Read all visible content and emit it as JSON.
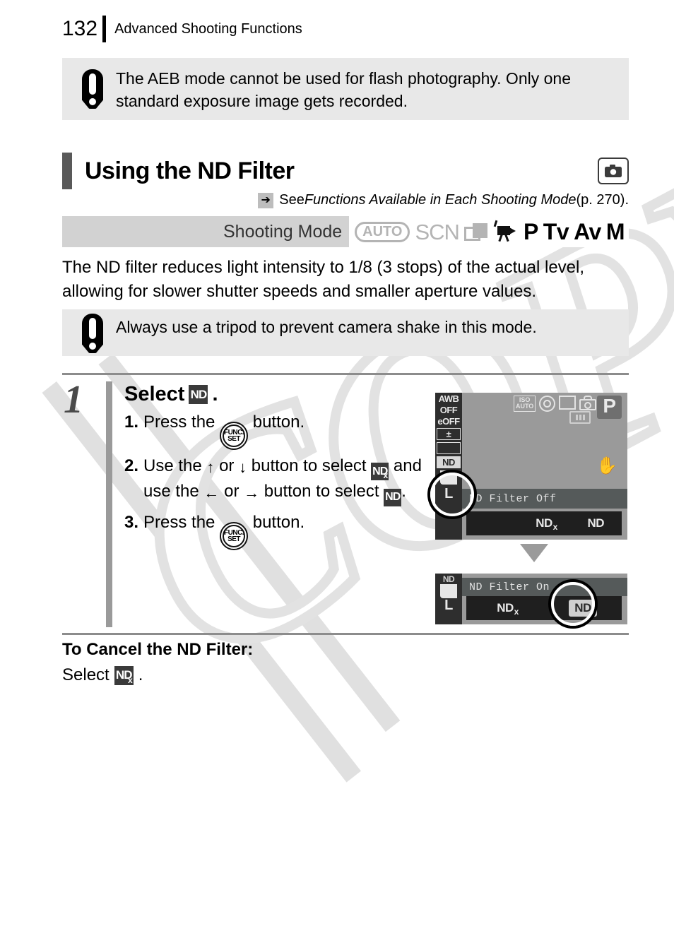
{
  "page": {
    "number": "132",
    "running_title": "Advanced Shooting Functions"
  },
  "notes": {
    "aeb": "The AEB mode cannot be used for flash photography. Only one standard exposure image gets recorded.",
    "tripod": "Always use a tripod to prevent camera shake in this mode."
  },
  "section": {
    "heading": "Using the ND Filter",
    "camera_icon": "camera-icon",
    "see_ref": {
      "arrow_glyph": "➔",
      "prefix": "See ",
      "italic_title": "Functions Available in Each Shooting Mode",
      "suffix": " (p. 270)."
    }
  },
  "shooting_mode": {
    "label": "Shooting Mode",
    "modes": [
      {
        "name": "auto",
        "label": "AUTO",
        "enabled": false
      },
      {
        "name": "scn",
        "label": "SCN",
        "enabled": false
      },
      {
        "name": "stitch-assist",
        "label": "",
        "enabled": false
      },
      {
        "name": "movie",
        "label": "",
        "enabled": true
      },
      {
        "name": "program",
        "label": "P",
        "enabled": true
      },
      {
        "name": "shutter-priority",
        "label": "Tv",
        "enabled": true
      },
      {
        "name": "aperture-priority",
        "label": "Av",
        "enabled": true
      },
      {
        "name": "manual",
        "label": "M",
        "enabled": true
      }
    ]
  },
  "body_paragraph": "The ND filter reduces light intensity to 1/8 (3 stops) of the actual level, allowing for slower shutter speeds and smaller aperture values.",
  "step": {
    "number": "1",
    "title_prefix": "Select",
    "title_badge": "ND",
    "title_suffix": ".",
    "items": [
      {
        "num": "1.",
        "parts": [
          "Press the ",
          "FUNC-SET",
          " button."
        ]
      },
      {
        "num": "2.",
        "parts": [
          "Use the ",
          "↑",
          " or ",
          "↓",
          " button to select ",
          "NDx",
          " and use the ",
          "←",
          " or ",
          "→",
          " button to select ",
          "ND",
          "."
        ]
      },
      {
        "num": "3.",
        "parts": [
          "Press the ",
          "FUNC-SET",
          " button."
        ]
      }
    ],
    "func_button": {
      "line1": "FUNC.",
      "line2": "SET"
    }
  },
  "lcd_top": {
    "left_column": [
      "AWB",
      "OFF",
      "eOFF",
      "±",
      "drive",
      "ND",
      "quality",
      "L"
    ],
    "nd_menu_selected": "ND",
    "top_icons": {
      "iso_line1": "ISO",
      "iso_line2": "AUTO",
      "mode_letter": "P"
    },
    "status_text": "ND Filter Off",
    "options": [
      {
        "name": "blank",
        "label": "",
        "active": false
      },
      {
        "name": "nd-off",
        "label": "ND",
        "sub": "x",
        "active": false
      },
      {
        "name": "nd-on",
        "label": "ND",
        "sub": "",
        "active": false
      }
    ]
  },
  "lcd_bottom": {
    "corner_label": "ND",
    "quality_label": "L",
    "status_text": "ND Filter On",
    "options": [
      {
        "name": "nd-off",
        "label": "ND",
        "sub": "x",
        "active": false
      },
      {
        "name": "nd-on",
        "label": "ND",
        "sub": "",
        "active": true
      }
    ]
  },
  "cancel": {
    "title": "To Cancel the ND Filter:",
    "instruction": "Select",
    "badge": "ND",
    "badge_sub": "x",
    "period": "."
  },
  "watermark": {
    "text": "COPY"
  },
  "colors": {
    "note_bg": "#e8e8e8",
    "mode_bar_bg": "#d2d2d2",
    "accent_gray": "#595959",
    "rule_gray": "#8c8c8c",
    "lcd_bg": "#9a9a9a",
    "disabled_mode": "#b4b4b4"
  }
}
